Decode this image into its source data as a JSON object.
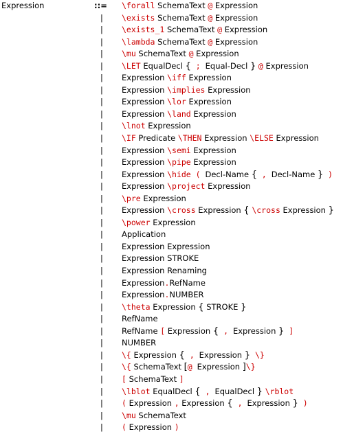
{
  "nonterminal": "Expression",
  "defines": "::=",
  "bar": "|",
  "rows": [
    [
      {
        "t": "\\forall",
        "k": 1
      },
      {
        "t": " SchemaText "
      },
      {
        "t": "@",
        "k": 1
      },
      {
        "t": " Expression"
      }
    ],
    [
      {
        "t": "\\exists",
        "k": 1
      },
      {
        "t": " SchemaText "
      },
      {
        "t": "@",
        "k": 1
      },
      {
        "t": " Expression"
      }
    ],
    [
      {
        "t": "\\exists_1",
        "k": 1
      },
      {
        "t": " SchemaText "
      },
      {
        "t": "@",
        "k": 1
      },
      {
        "t": " Expression"
      }
    ],
    [
      {
        "t": "\\lambda",
        "k": 1
      },
      {
        "t": " SchemaText "
      },
      {
        "t": "@",
        "k": 1
      },
      {
        "t": " Expression"
      }
    ],
    [
      {
        "t": "\\mu",
        "k": 1
      },
      {
        "t": " SchemaText "
      },
      {
        "t": "@",
        "k": 1
      },
      {
        "t": " Expression"
      }
    ],
    [
      {
        "t": "\\LET",
        "k": 1
      },
      {
        "t": " EqualDecl "
      },
      {
        "t": "{",
        "b": 1
      },
      {
        "t": " ; ",
        "k": 1
      },
      {
        "t": "Equal-Decl "
      },
      {
        "t": "}",
        "b": 1
      },
      {
        "t": " "
      },
      {
        "t": "@",
        "k": 1
      },
      {
        "t": " Expression"
      }
    ],
    [
      {
        "t": "Expression "
      },
      {
        "t": "\\iff",
        "k": 1
      },
      {
        "t": " Expression"
      }
    ],
    [
      {
        "t": "Expression "
      },
      {
        "t": "\\implies",
        "k": 1
      },
      {
        "t": " Expression"
      }
    ],
    [
      {
        "t": "Expression "
      },
      {
        "t": "\\lor",
        "k": 1
      },
      {
        "t": " Expression"
      }
    ],
    [
      {
        "t": "Expression "
      },
      {
        "t": "\\land",
        "k": 1
      },
      {
        "t": " Expression"
      }
    ],
    [
      {
        "t": "\\lnot",
        "k": 1
      },
      {
        "t": " Expression"
      }
    ],
    [
      {
        "t": "\\IF",
        "k": 1
      },
      {
        "t": " Predicate "
      },
      {
        "t": "\\THEN",
        "k": 1
      },
      {
        "t": " Expression "
      },
      {
        "t": "\\ELSE",
        "k": 1
      },
      {
        "t": " Expression"
      }
    ],
    [
      {
        "t": "Expression "
      },
      {
        "t": "\\semi",
        "k": 1
      },
      {
        "t": " Expression"
      }
    ],
    [
      {
        "t": "Expression "
      },
      {
        "t": "\\pipe",
        "k": 1
      },
      {
        "t": " Expression"
      }
    ],
    [
      {
        "t": "Expression "
      },
      {
        "t": "\\hide",
        "k": 1
      },
      {
        "t": " ( ",
        "k": 1
      },
      {
        "t": "Decl-Name "
      },
      {
        "t": "{",
        "b": 1
      },
      {
        "t": " , ",
        "k": 1
      },
      {
        "t": "Decl-Name "
      },
      {
        "t": "}",
        "b": 1
      },
      {
        "t": " )",
        "k": 1
      }
    ],
    [
      {
        "t": "Expression "
      },
      {
        "t": "\\project",
        "k": 1
      },
      {
        "t": " Expression"
      }
    ],
    [
      {
        "t": "\\pre",
        "k": 1
      },
      {
        "t": " Expression"
      }
    ],
    [
      {
        "t": "Expression "
      },
      {
        "t": "\\cross",
        "k": 1
      },
      {
        "t": " Expression "
      },
      {
        "t": "{",
        "b": 1
      },
      {
        "t": " "
      },
      {
        "t": "\\cross",
        "k": 1
      },
      {
        "t": " Expression "
      },
      {
        "t": "}",
        "b": 1
      }
    ],
    [
      {
        "t": "\\power",
        "k": 1
      },
      {
        "t": " Expression"
      }
    ],
    [
      {
        "t": "Application"
      }
    ],
    [
      {
        "t": "Expression Expression"
      }
    ],
    [
      {
        "t": "Expression STROKE"
      }
    ],
    [
      {
        "t": "Expression Renaming"
      }
    ],
    [
      {
        "t": "Expression"
      },
      {
        "t": ".",
        "k": 1
      },
      {
        "t": "RefName"
      }
    ],
    [
      {
        "t": "Expression"
      },
      {
        "t": ".",
        "k": 1
      },
      {
        "t": "NUMBER"
      }
    ],
    [
      {
        "t": "\\theta",
        "k": 1
      },
      {
        "t": " Expression "
      },
      {
        "t": "{",
        "b": 1
      },
      {
        "t": " STROKE "
      },
      {
        "t": "}",
        "b": 1
      }
    ],
    [
      {
        "t": "RefName"
      }
    ],
    [
      {
        "t": "RefName "
      },
      {
        "t": "[",
        "k": 1
      },
      {
        "t": " Expression "
      },
      {
        "t": "{",
        "b": 1
      },
      {
        "t": " , ",
        "k": 1
      },
      {
        "t": "Expression "
      },
      {
        "t": "}",
        "b": 1
      },
      {
        "t": " ]",
        "k": 1
      }
    ],
    [
      {
        "t": "NUMBER"
      }
    ],
    [
      {
        "t": "\\{",
        "k": 1
      },
      {
        "t": " Expression "
      },
      {
        "t": "{",
        "b": 1
      },
      {
        "t": " , ",
        "k": 1
      },
      {
        "t": "Expression "
      },
      {
        "t": "}",
        "b": 1
      },
      {
        "t": " \\}",
        "k": 1
      }
    ],
    [
      {
        "t": "\\{",
        "k": 1
      },
      {
        "t": " SchemaText "
      },
      {
        "t": "[",
        "b": 1
      },
      {
        "t": "@ ",
        "k": 1
      },
      {
        "t": "Expression "
      },
      {
        "t": "]",
        "b": 1
      },
      {
        "t": "\\}",
        "k": 1
      }
    ],
    [
      {
        "t": "[",
        "k": 1
      },
      {
        "t": " SchemaText "
      },
      {
        "t": "]",
        "k": 1
      }
    ],
    [
      {
        "t": "\\lblot",
        "k": 1
      },
      {
        "t": " EqualDecl "
      },
      {
        "t": "{",
        "b": 1
      },
      {
        "t": " , ",
        "k": 1
      },
      {
        "t": "EqualDecl "
      },
      {
        "t": "}",
        "b": 1
      },
      {
        "t": " "
      },
      {
        "t": "\\rblot",
        "k": 1
      }
    ],
    [
      {
        "t": "(",
        "k": 1
      },
      {
        "t": " Expression "
      },
      {
        "t": ",",
        "k": 1
      },
      {
        "t": " Expression "
      },
      {
        "t": "{",
        "b": 1
      },
      {
        "t": " , ",
        "k": 1
      },
      {
        "t": "Expression "
      },
      {
        "t": "}",
        "b": 1
      },
      {
        "t": " )",
        "k": 1
      }
    ],
    [
      {
        "t": "\\mu",
        "k": 1
      },
      {
        "t": " SchemaText"
      }
    ],
    [
      {
        "t": "(",
        "k": 1
      },
      {
        "t": " Expression "
      },
      {
        "t": ")",
        "k": 1
      }
    ]
  ]
}
